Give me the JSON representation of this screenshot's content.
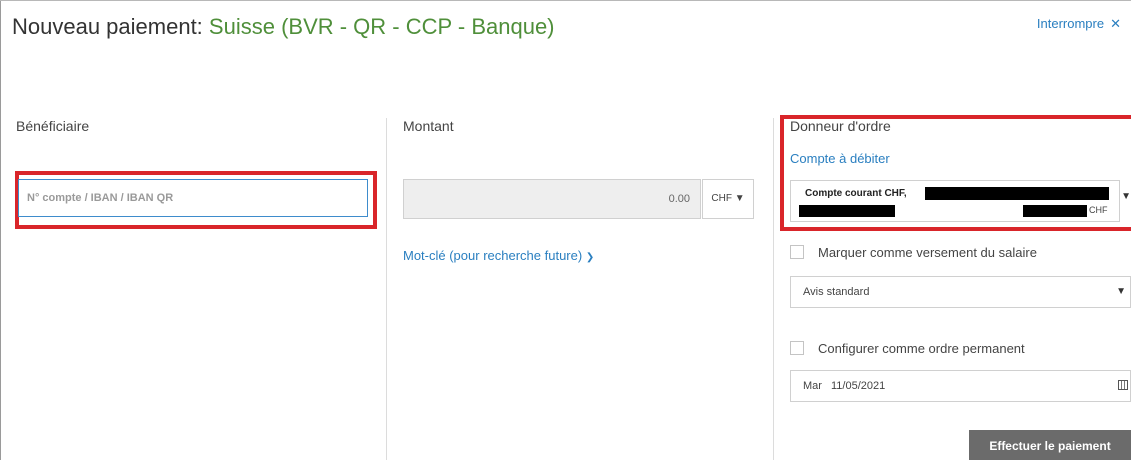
{
  "header": {
    "title_prefix": "Nouveau paiement:",
    "title_country": "Suisse (BVR - QR - CCP - Banque)",
    "abort_label": "Interrompre",
    "abort_icon": "close-icon"
  },
  "beneficiary": {
    "label": "Bénéficiaire",
    "iban_placeholder": "N° compte / IBAN / IBAN QR"
  },
  "amount": {
    "label": "Montant",
    "value": "0.00",
    "currency": "CHF",
    "keyword_link": "Mot-clé (pour recherche future)"
  },
  "order": {
    "label": "Donneur d'ordre",
    "account_link": "Compte à débiter",
    "account_name": "Compte courant CHF,",
    "account_currency": "CHF",
    "salary_checkbox_label": "Marquer comme versement du salaire",
    "notice_value": "Avis standard",
    "standing_order_label": "Configurer comme ordre permanent",
    "date_day": "Mar",
    "date_value": "11/05/2021",
    "submit_label": "Effectuer le paiement"
  },
  "colors": {
    "accent_link": "#2a7fc0",
    "title_country": "#4f8f3a",
    "highlight": "#d9252a",
    "submit_bg": "#6b6b6b"
  }
}
